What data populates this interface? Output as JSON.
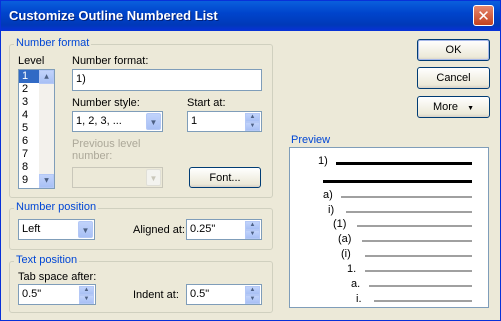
{
  "dialog": {
    "title": "Customize Outline Numbered List",
    "close_glyph": "✕"
  },
  "number_format": {
    "group_label": "Number format",
    "level_label": "Level",
    "levels": [
      "1",
      "2",
      "3",
      "4",
      "5",
      "6",
      "7",
      "8",
      "9"
    ],
    "selected_level": "1",
    "number_format_label": "Number format:",
    "number_format_value": "1)",
    "number_style_label": "Number style:",
    "number_style_value": "1, 2, 3, ...",
    "start_at_label": "Start at:",
    "start_at_value": "1",
    "previous_level_label_1": "Previous level",
    "previous_level_label_2": "number:",
    "previous_level_value": "",
    "font_button": "Font..."
  },
  "number_position": {
    "group_label": "Number position",
    "alignment_value": "Left",
    "aligned_at_label": "Aligned at:",
    "aligned_at_value": "0.25\""
  },
  "text_position": {
    "group_label": "Text position",
    "tab_space_label": "Tab space after:",
    "tab_space_value": "0.5\"",
    "indent_at_label": "Indent at:",
    "indent_at_value": "0.5\""
  },
  "buttons": {
    "ok": "OK",
    "cancel": "Cancel",
    "more": "More",
    "more_arrow": "▼"
  },
  "preview": {
    "label": "Preview",
    "rows": [
      {
        "marker": "1)",
        "bold": true
      },
      {
        "marker": "",
        "bold": true
      },
      {
        "marker": "a)",
        "bold": false
      },
      {
        "marker": "i)",
        "bold": false
      },
      {
        "marker": "(1)",
        "bold": false
      },
      {
        "marker": "(a)",
        "bold": false
      },
      {
        "marker": "(i)",
        "bold": false
      },
      {
        "marker": "1.",
        "bold": false
      },
      {
        "marker": "a.",
        "bold": false
      },
      {
        "marker": "i.",
        "bold": false
      }
    ]
  }
}
